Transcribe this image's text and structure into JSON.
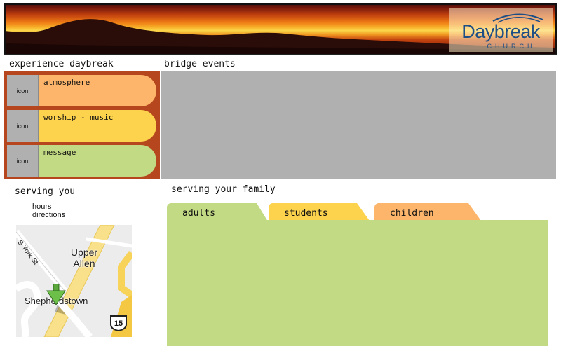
{
  "banner": {
    "logo_name": "Daybreak",
    "logo_subtitle": "CHURCH",
    "logo_color": "#1d4e86"
  },
  "experience": {
    "heading": "experience daybreak",
    "panel_color": "#b5461d",
    "items": [
      {
        "icon_text": "icon",
        "label": "atmosphere",
        "color": "#fcb56a"
      },
      {
        "icon_text": "icon",
        "label": "worship - music",
        "color": "#fdd24c"
      },
      {
        "icon_text": "icon",
        "label": "message",
        "color": "#c2da83"
      }
    ]
  },
  "events": {
    "heading": "bridge events"
  },
  "serving_you": {
    "heading": "serving you",
    "links": [
      "hours",
      "directions"
    ],
    "map": {
      "labels": [
        "Upper\nAllen",
        "Shepherdstown"
      ],
      "street": "S York St",
      "route_shield": "15"
    }
  },
  "family": {
    "heading": "serving your family",
    "tabs": [
      {
        "label": "adults",
        "color": "#c2da83",
        "active": true
      },
      {
        "label": "students",
        "color": "#fdd24c",
        "active": false
      },
      {
        "label": "children",
        "color": "#fcb56a",
        "active": false
      }
    ]
  }
}
